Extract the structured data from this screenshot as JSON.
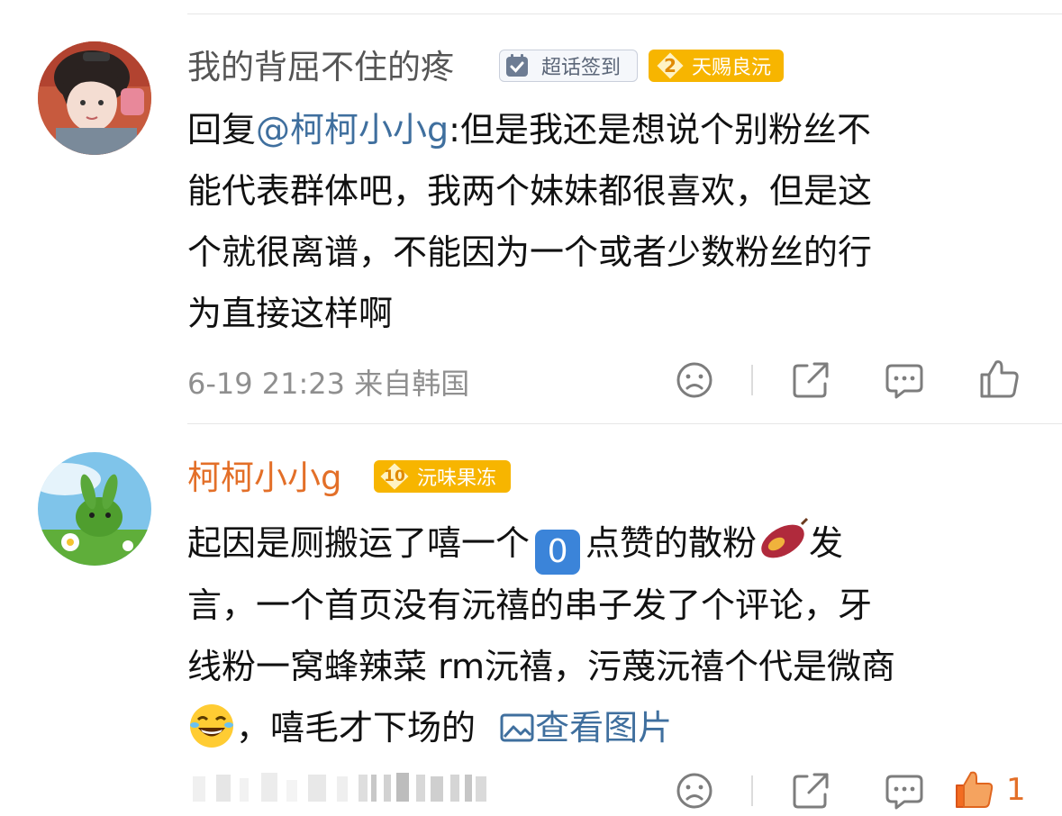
{
  "comments": [
    {
      "username": "我的背屈不住的疼",
      "badge_supertopic": "超话签到",
      "badge_level": "2",
      "badge_group": "天赐良沅",
      "reply_prefix": "回复",
      "mention": "@柯柯小小g",
      "text_line1": ":但是我还是想说个别粉丝不",
      "text_line2": "能代表群体吧，我两个妹妹都很喜欢，但是这",
      "text_line3": "个就很离谱，不能因为一个或者少数粉丝的行",
      "text_line4": "为直接这样啊",
      "meta": "6-19 21:23  来自韩国",
      "like_count": ""
    },
    {
      "username": "柯柯小小g",
      "badge_level": "10",
      "badge_group": "沅味果冻",
      "text_line1_a": "起因是厕搬运了嘻一个",
      "emoji_zero": "0",
      "text_line1_b": "点赞的散粉",
      "text_line1_c": "发",
      "text_line2": "言，一个首页没有沅禧的串子发了个评论，牙",
      "text_line3": "线粉一窝蜂辣菜 rm沅禧，污蔑沅禧个代是微商",
      "text_line4": "，嘻毛才下场的",
      "view_image_link": "查看图片",
      "meta_obscured": "",
      "like_count": "1"
    }
  ],
  "colors": {
    "username_gray": "#555555",
    "username_orange": "#e36f28",
    "link_blue": "#3f6f9e",
    "meta_gray": "#8f8f8f",
    "badge_gold": "#f7b500",
    "like_active": "#f36c21"
  },
  "icons": [
    "frown-icon",
    "share-icon",
    "comment-icon",
    "thumbs-up-icon",
    "image-icon",
    "sweet-potato-emoji",
    "laughing-emoji",
    "checkin-icon"
  ]
}
